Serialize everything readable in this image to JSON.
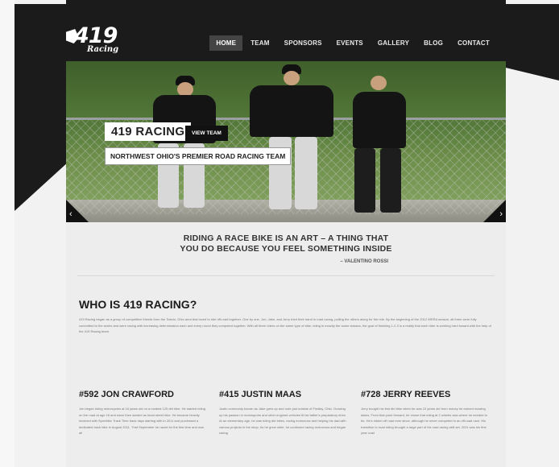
{
  "logo": {
    "number": "419",
    "sub": "Racing"
  },
  "nav": {
    "items": [
      "HOME",
      "TEAM",
      "SPONSORS",
      "EVENTS",
      "GALLERY",
      "BLOG",
      "CONTACT"
    ],
    "active": "HOME"
  },
  "hero": {
    "title": "419 RACING",
    "button": "VIEW TEAM",
    "subtitle": "NORTHWEST OHIO'S PREMIER ROAD RACING TEAM",
    "prev": "‹",
    "next": "›"
  },
  "quote": {
    "line1": "RIDING A RACE BIKE IS AN ART – A THING THAT",
    "line2": "YOU DO BECAUSE YOU FEEL SOMETHING INSIDE",
    "author": "– VALENTINO ROSSI"
  },
  "who": {
    "title": "WHO IS 419 RACING?",
    "body": "419 Racing began as a group of competitive friends from the Toledo, Ohio area that loved to ride off-road together. One by one, Jon, Jake, and Jerry tried their hand in road racing, pulling the others along for the ride. By the beginning of the 2012 WERA season, all three were fully committed to the series and were racing with increasing determination each and every round they competed together. With all three riders on the same type of bike, riding in exactly the same classes, the goal of finishing 1-2-3 is a reality that each rider is working hard toward with the help of the 419 Racing team."
  },
  "riders": [
    {
      "title": "#592 JON CRAWFORD",
      "text": "Jon began riding motorcycles at 16 years old on a modest 125 dirt bike. He started riding on the road at age 18 and since then started as head street bike. He became heavily involved with Sportbike Track Time track days starting with in 2011 and purchased a dedicated track bike in August 2011. That September he raced for the first time and won all"
    },
    {
      "title": "#415 JUSTIN MAAS",
      "text": "Justin commonly known as Jake grew up and rode just outside of Findlay, Ohio. Growing up his passion in motorsports and other engined vehicles fit his father's preparatory drive. At an elementary age, he was riding dirt bikes, racing motocross and helping his dad with various projects in the shop. As he grew older, he continued racing motocross and began racing"
    },
    {
      "title": "#728 JERRY REEVES",
      "text": "Jerry bought his first dirt bike when he was 10 years old from money he earned mowing lawns. From that point forward, he chose that riding at 2 wheels was where he needed to be. He's ridden off road ever since, although he never competed in an off-road race. His transition to road riding brought a large part of his road racing skill set. 2011 was his first year road"
    }
  ],
  "colors": {
    "header": "#1b1b1b",
    "page": "#ededed",
    "background": "#f2f2f2"
  }
}
